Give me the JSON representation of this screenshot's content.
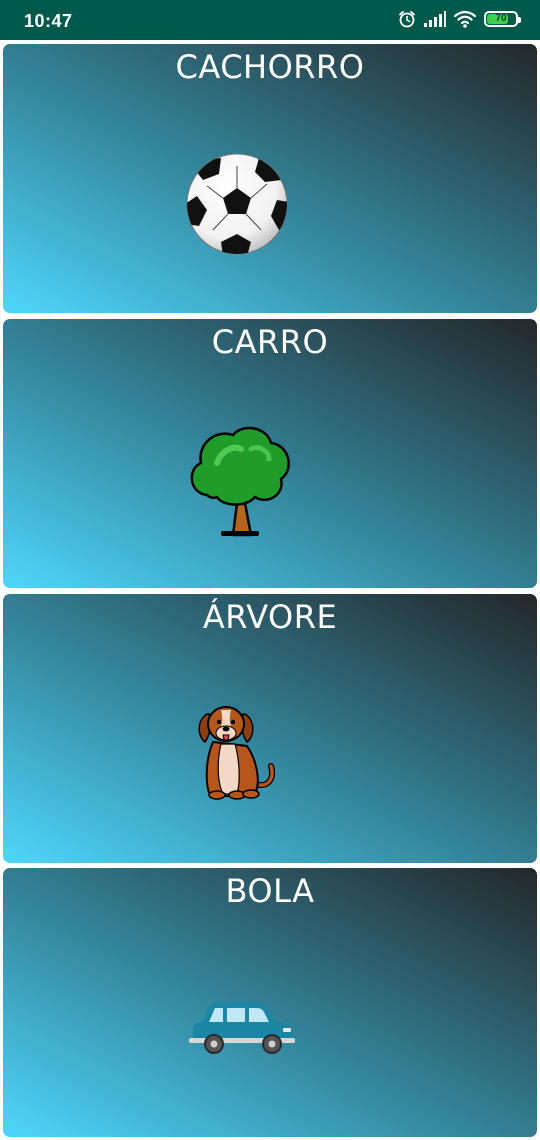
{
  "status_bar": {
    "time": "10:47",
    "icons": [
      "alarm-icon",
      "signal-icon",
      "wifi-icon",
      "battery-icon"
    ],
    "battery_level": "70",
    "background_color": "#00594a"
  },
  "cards": [
    {
      "title": "CACHORRO",
      "image": "soccer-ball-icon"
    },
    {
      "title": "CARRO",
      "image": "tree-icon"
    },
    {
      "title": "ÁRVORE",
      "image": "dog-icon"
    },
    {
      "title": "BOLA",
      "image": "car-icon"
    }
  ],
  "colors": {
    "card_gradient_start": "#4ed6fc",
    "card_gradient_end": "#232729",
    "title_text": "#ffffff"
  }
}
